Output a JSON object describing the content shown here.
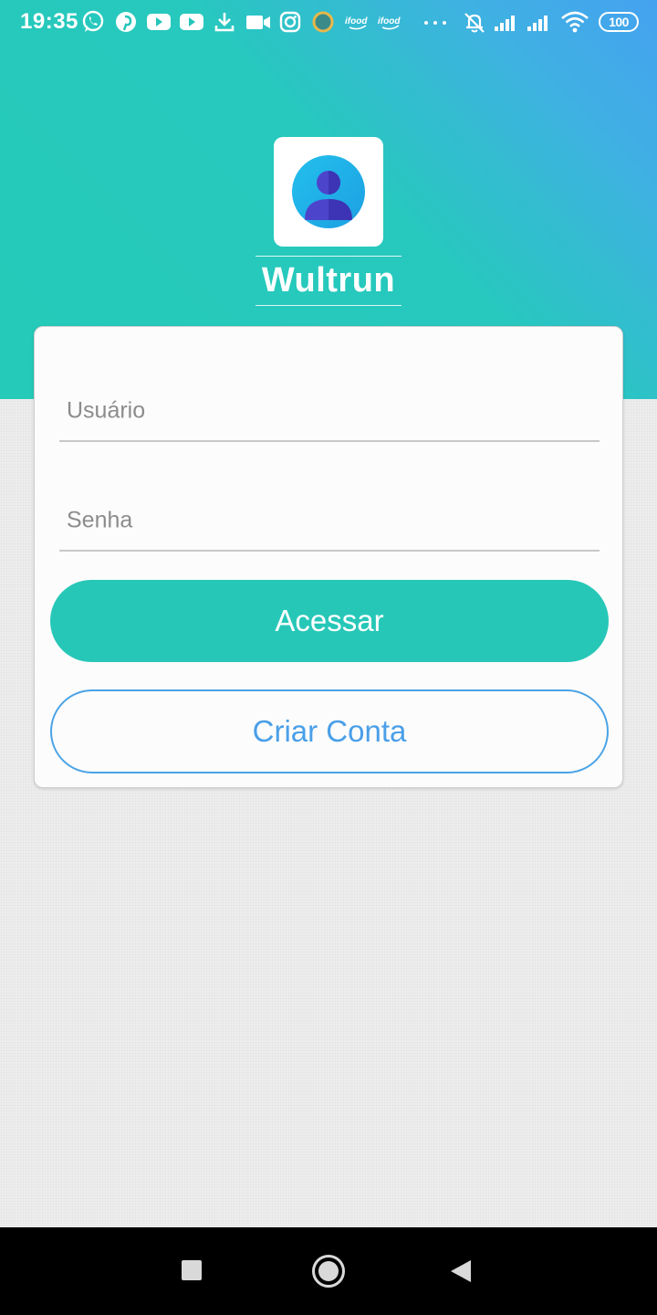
{
  "status_bar": {
    "time": "19:35",
    "battery": "100",
    "notification_icons": [
      "whatsapp-icon",
      "pinterest-icon",
      "youtube-icon",
      "youtube-icon",
      "download-icon",
      "video-camera-icon",
      "instagram-icon",
      "app-circle-icon",
      "ifood-icon",
      "ifood-icon",
      "more-dots-icon"
    ],
    "system_icons": [
      "bell-off-icon",
      "signal-icon",
      "signal-icon",
      "wifi-icon",
      "battery-icon"
    ],
    "ifood_label": "ifood"
  },
  "app": {
    "title": "Wultrun",
    "logo_icon": "user-avatar-icon"
  },
  "form": {
    "username_placeholder": "Usuário",
    "password_placeholder": "Senha",
    "login_button": "Acessar",
    "create_account_button": "Criar Conta"
  },
  "nav_bar": {
    "icons": [
      "recents-icon",
      "home-icon",
      "back-icon"
    ]
  },
  "colors": {
    "primary": "#25cbb8",
    "accent_blue": "#45a2f0",
    "card": "#fcfcfc",
    "background": "#ededed"
  }
}
